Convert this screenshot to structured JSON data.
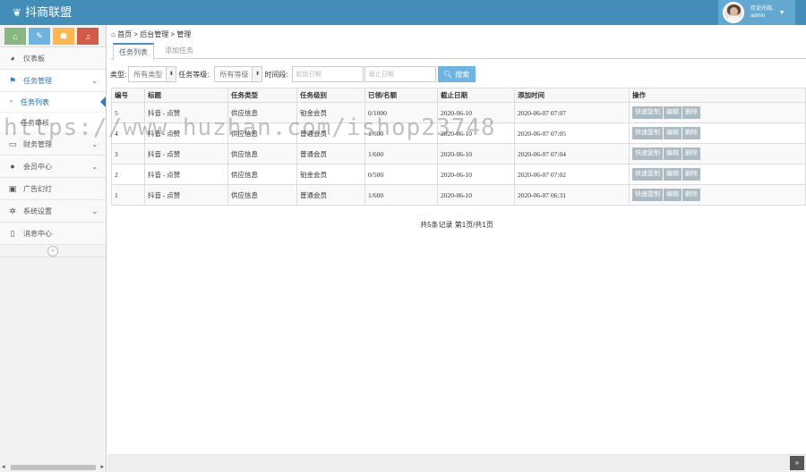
{
  "header": {
    "brand": "抖商联盟",
    "welcome": "欢迎光临,",
    "username": "admin"
  },
  "sidebar": {
    "shortcuts": [
      {
        "icon": "home-icon",
        "glyph": "⌂",
        "color": "#87b87f"
      },
      {
        "icon": "pencil-icon",
        "glyph": "✎",
        "color": "#6fb3e0"
      },
      {
        "icon": "users-icon",
        "glyph": "☗",
        "color": "#ffb752"
      },
      {
        "icon": "bell-icon",
        "glyph": "♫",
        "color": "#d15b47"
      }
    ],
    "items": [
      {
        "label": "仪表板",
        "icon": "dashboard-icon",
        "glyph": "◕"
      },
      {
        "label": "任务管理",
        "icon": "flag-icon",
        "glyph": "⚑",
        "active": true,
        "children": [
          {
            "label": "任务列表",
            "active": true
          },
          {
            "label": "任务审核"
          }
        ]
      },
      {
        "label": "财务管理",
        "icon": "printer-icon",
        "glyph": "▭"
      },
      {
        "label": "会员中心",
        "icon": "user-icon",
        "glyph": "●"
      },
      {
        "label": "广告幻灯",
        "icon": "picture-icon",
        "glyph": "▣"
      },
      {
        "label": "系统设置",
        "icon": "gear-icon",
        "glyph": "✲"
      },
      {
        "label": "消息中心",
        "icon": "bookmark-icon",
        "glyph": "▯"
      }
    ]
  },
  "breadcrumb": {
    "home": "首页",
    "level1": "后台管理",
    "level2": "管理"
  },
  "tabs": [
    "任务列表",
    "添加任务"
  ],
  "filter": {
    "type_label": "类型:",
    "type_value": "所有类型",
    "level_label": "任务等级:",
    "level_value": "所有等级",
    "period_label": "时间段:",
    "start_placeholder": "起始日期",
    "end_placeholder": "截止日期",
    "search_label": "搜索"
  },
  "table": {
    "columns": [
      "编号",
      "标题",
      "任务类型",
      "任务级别",
      "已领/名额",
      "截止日期",
      "添加时间",
      "操作"
    ],
    "rows": [
      [
        "5",
        "抖音 - 点赞",
        "供应信息",
        "铂金会员",
        "0/1000",
        "2020-06-10",
        "2020-06-07 07:07"
      ],
      [
        "4",
        "抖音 - 点赞",
        "供应信息",
        "普通会员",
        "1/600",
        "2020-06-10",
        "2020-06-07 07:05"
      ],
      [
        "3",
        "抖音 - 点赞",
        "供应信息",
        "普通会员",
        "1/600",
        "2020-06-10",
        "2020-06-07 07:04"
      ],
      [
        "2",
        "抖音 - 点赞",
        "供应信息",
        "铂金会员",
        "0/500",
        "2020-06-10",
        "2020-06-07 07:02"
      ],
      [
        "1",
        "抖音 - 点赞",
        "供应信息",
        "普通会员",
        "1/600",
        "2020-06-10",
        "2020-06-07 06:31"
      ]
    ],
    "actions": [
      "快速复制",
      "编辑",
      "删除"
    ]
  },
  "pager": "共5条记录 第1页/共1页",
  "watermark": "https://www.huzhan.com/ishop23748"
}
